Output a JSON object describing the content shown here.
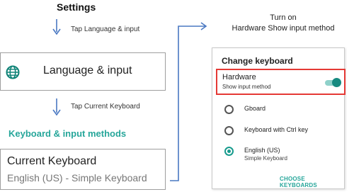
{
  "left": {
    "title": "Settings",
    "step1": "Tap Language & input",
    "language_item": {
      "icon": "globe-icon",
      "label": "Language & input"
    },
    "step2": "Tap Current Keyboard",
    "section_header": "Keyboard & input methods",
    "current_keyboard": {
      "title": "Current Keyboard",
      "value": "English (US) - Simple Keyboard"
    }
  },
  "right": {
    "instruction": {
      "line1": "Turn on",
      "line2": "Hardware Show input method"
    },
    "dialog": {
      "title": "Change keyboard",
      "hardware": {
        "title": "Hardware",
        "subtitle": "Show input method",
        "toggle_on": true
      },
      "options": [
        {
          "label": "Gboard",
          "selected": false
        },
        {
          "label": "Keyboard with Ctrl key",
          "selected": false
        },
        {
          "label": "English (US)",
          "sublabel": "Simple Keyboard",
          "selected": true
        }
      ],
      "action": "CHOOSE KEYBOARDS"
    }
  },
  "colors": {
    "accent": "#26a69a",
    "arrow": "#4a78c2",
    "highlight": "#e53935",
    "border": "#9e9e9e"
  }
}
